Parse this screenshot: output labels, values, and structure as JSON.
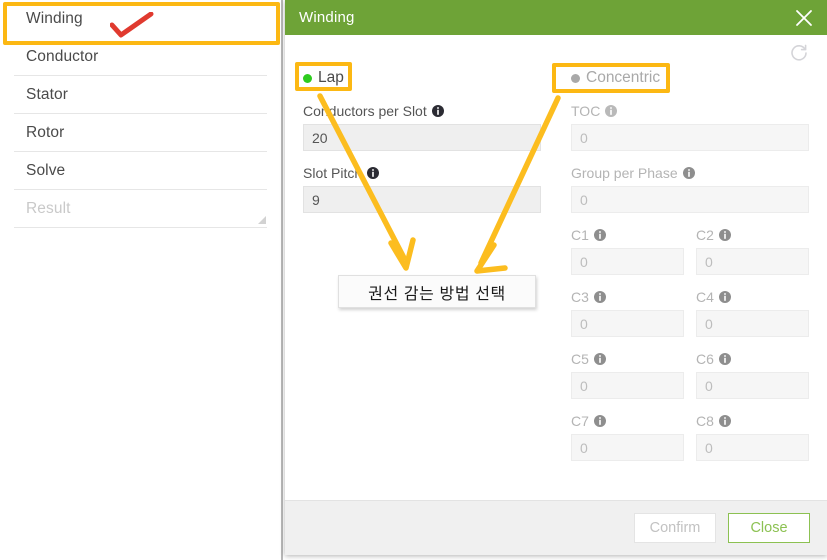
{
  "sidebar": {
    "items": [
      {
        "label": "Winding",
        "state": "selected",
        "highlighted": true
      },
      {
        "label": "Conductor",
        "state": "normal",
        "highlighted": false
      },
      {
        "label": "Stator",
        "state": "normal",
        "highlighted": false
      },
      {
        "label": "Rotor",
        "state": "normal",
        "highlighted": false
      },
      {
        "label": "Solve",
        "state": "normal",
        "highlighted": false
      },
      {
        "label": "Result",
        "state": "disabled",
        "highlighted": false
      }
    ],
    "check_mark_icon": "check-icon"
  },
  "dialog": {
    "title": "Winding",
    "close_icon": "close-icon",
    "refresh_icon": "refresh-icon",
    "header_color": "#6ea337",
    "modes": [
      {
        "id": "lap",
        "label": "Lap",
        "selected": true,
        "dot_color": "#2ecc1f"
      },
      {
        "id": "concentric",
        "label": "Concentric",
        "selected": false,
        "dot_color": "#a9a9a9"
      }
    ],
    "left_fields": [
      {
        "label": "Conductors per Slot",
        "value": "20",
        "disabled": false,
        "info_icon": "info-icon"
      },
      {
        "label": "Slot Pitch",
        "value": "9",
        "disabled": false,
        "info_icon": "info-icon"
      }
    ],
    "right_fields": [
      {
        "label": "TOC",
        "value": "0",
        "disabled": true,
        "info_icon": "info-icon"
      },
      {
        "label": "Group per Phase",
        "value": "0",
        "disabled": true,
        "info_icon": "info-icon"
      }
    ],
    "coil_fields": [
      {
        "label": "C1",
        "value": "0",
        "disabled": true,
        "info_icon": "info-icon"
      },
      {
        "label": "C2",
        "value": "0",
        "disabled": true,
        "info_icon": "info-icon"
      },
      {
        "label": "C3",
        "value": "0",
        "disabled": true,
        "info_icon": "info-icon"
      },
      {
        "label": "C4",
        "value": "0",
        "disabled": true,
        "info_icon": "info-icon"
      },
      {
        "label": "C5",
        "value": "0",
        "disabled": true,
        "info_icon": "info-icon"
      },
      {
        "label": "C6",
        "value": "0",
        "disabled": true,
        "info_icon": "info-icon"
      },
      {
        "label": "C7",
        "value": "0",
        "disabled": true,
        "info_icon": "info-icon"
      },
      {
        "label": "C8",
        "value": "0",
        "disabled": true,
        "info_icon": "info-icon"
      }
    ],
    "footer": {
      "confirm_label": "Confirm",
      "confirm_disabled": true,
      "close_label": "Close",
      "close_color": "#8cc152"
    }
  },
  "annotations": {
    "highlight_color": "#fcb813",
    "check_color": "#e03a2f",
    "callout_text": "권선 감는 방법 선택",
    "boxes": [
      "winding-nav-item",
      "lap-mode",
      "concentric-mode"
    ],
    "arrows": [
      "lap-to-callout",
      "concentric-to-callout"
    ]
  }
}
